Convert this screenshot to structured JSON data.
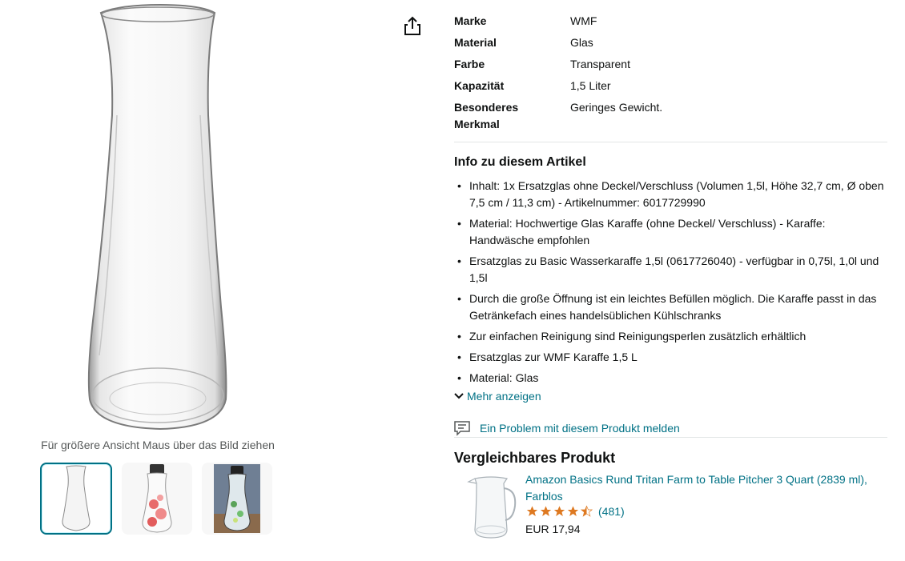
{
  "gallery": {
    "zoom_hint": "Für größere Ansicht Maus über das Bild ziehen",
    "thumbnails": [
      "karaffe-glas",
      "karaffe-mit-deckel-grapefruit",
      "karaffe-mit-deckel-minze"
    ]
  },
  "specs": [
    {
      "key": "Marke",
      "value": "WMF"
    },
    {
      "key": "Material",
      "value": "Glas"
    },
    {
      "key": "Farbe",
      "value": "Transparent"
    },
    {
      "key": "Kapazität",
      "value": "1,5 Liter"
    },
    {
      "key": "Besonderes Merkmal",
      "value": "Geringes Gewicht."
    }
  ],
  "info": {
    "title": "Info zu diesem Artikel",
    "bullets": [
      "Inhalt: 1x Ersatzglas ohne Deckel/Verschluss (Volumen 1,5l, Höhe 32,7 cm, Ø oben 7,5 cm / 11,3 cm) - Artikelnummer: 6017729990",
      "Material: Hochwertige Glas Karaffe (ohne Deckel/ Verschluss) - Karaffe: Handwäsche empfohlen",
      "Ersatzglas zu Basic Wasserkaraffe 1,5l (0617726040) - verfügbar in 0,75l, 1,0l und 1,5l",
      "Durch die große Öffnung ist ein leichtes Befüllen möglich. Die Karaffe passt in das Getränkefach eines handelsüblichen Kühlschranks",
      "Zur einfachen Reinigung sind Reinigungsperlen zusätzlich erhältlich",
      "Ersatzglas zur WMF Karaffe 1,5 L",
      "Material: Glas"
    ],
    "more_label": "Mehr anzeigen"
  },
  "report_label": "Ein Problem mit diesem Produkt melden",
  "compare": {
    "title": "Vergleichbares Produkt",
    "product_name": "Amazon Basics Rund Tritan Farm to Table Pitcher 3 Quart (2839 ml), Farblos",
    "rating": 4.5,
    "reviews": "(481)",
    "price": "EUR 17,94"
  },
  "colors": {
    "link": "#007185",
    "star": "#de7921",
    "accent": "#007185"
  }
}
